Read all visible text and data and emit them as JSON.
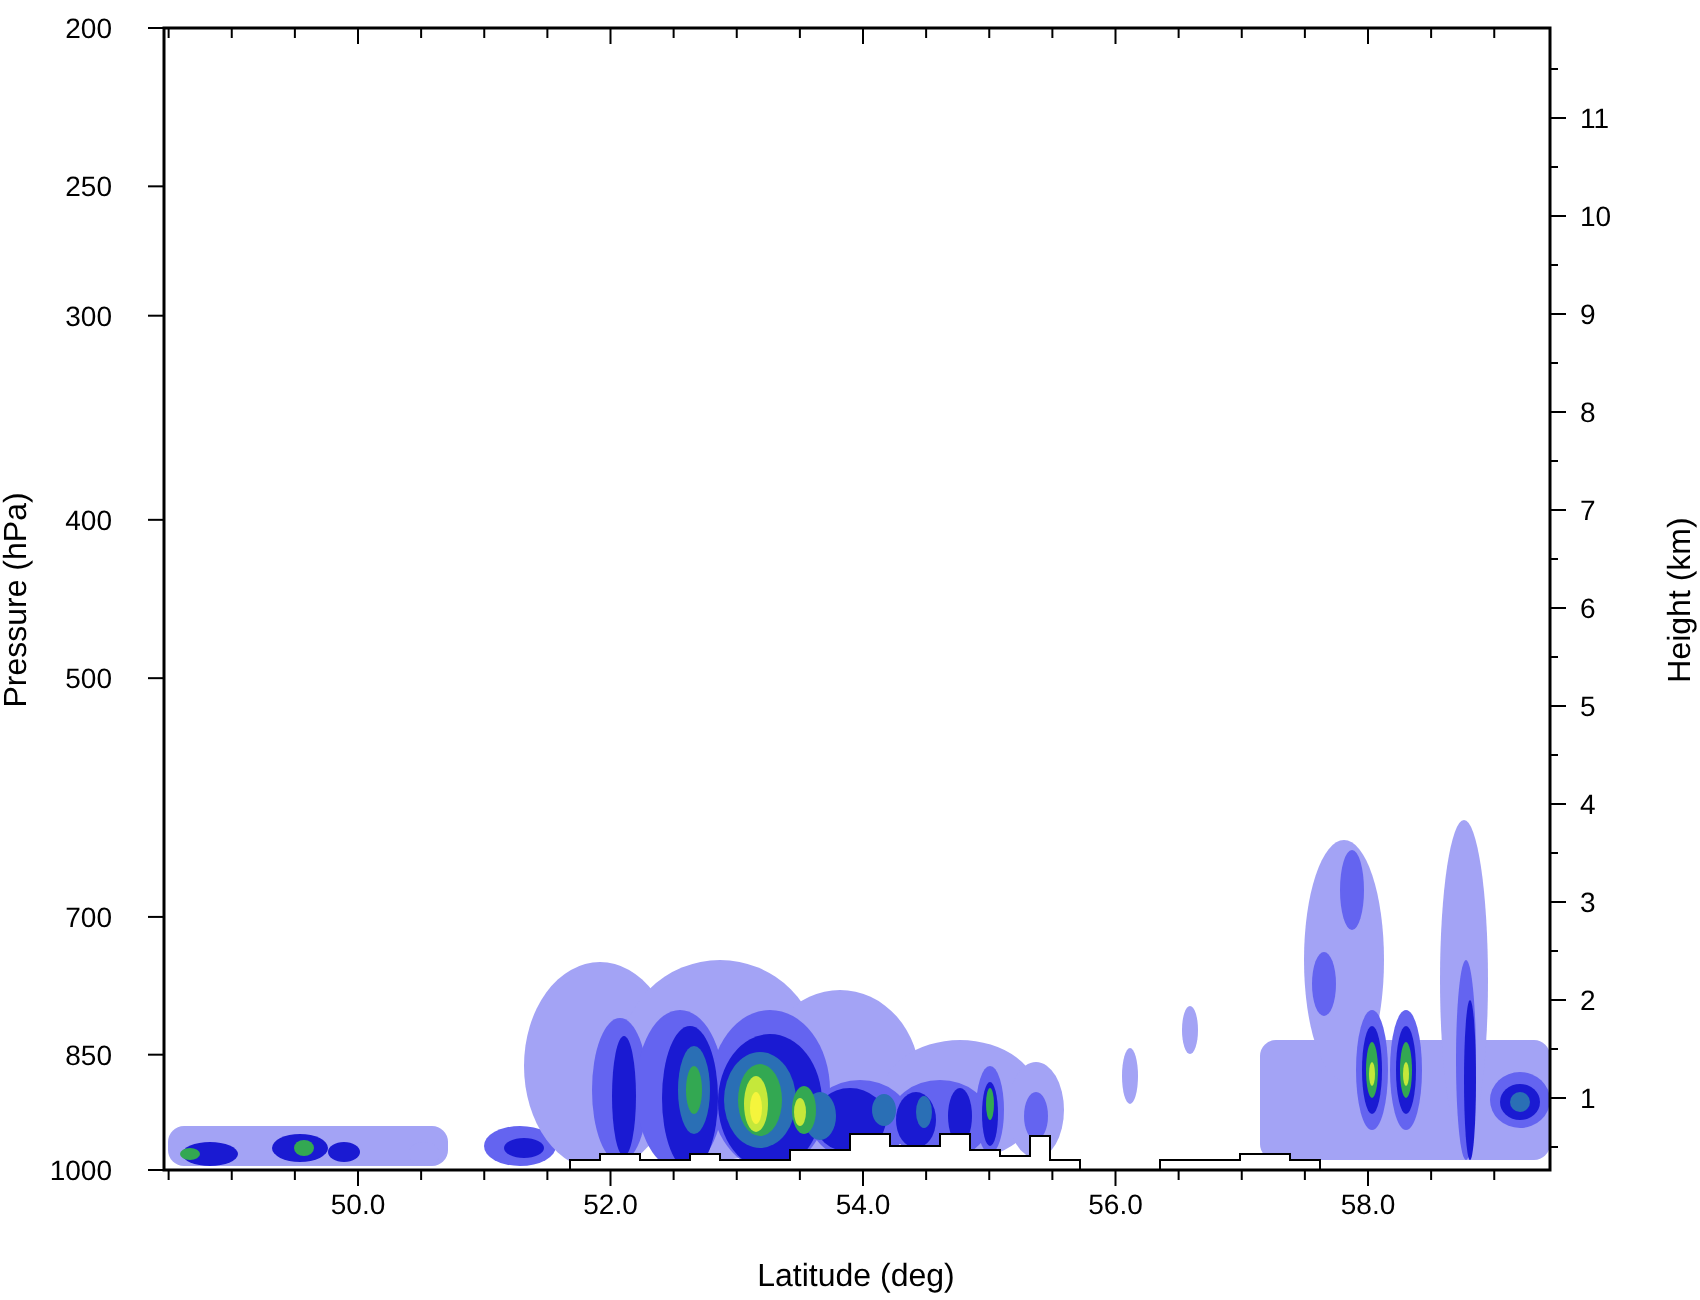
{
  "chart": {
    "left_axis": {
      "title": "Pressure (hPa)",
      "ticks": [
        "200",
        "250",
        "300",
        "400",
        "500",
        "700",
        "850",
        "1000"
      ]
    },
    "right_axis": {
      "title": "Height (km)",
      "ticks": [
        "11",
        "10",
        "9",
        "8",
        "7",
        "6",
        "5",
        "4",
        "3",
        "2",
        "1"
      ]
    },
    "bottom_axis": {
      "title": "Latitude (deg)",
      "ticks": [
        "50.0",
        "52.0",
        "54.0",
        "56.0",
        "58.0"
      ]
    }
  }
}
